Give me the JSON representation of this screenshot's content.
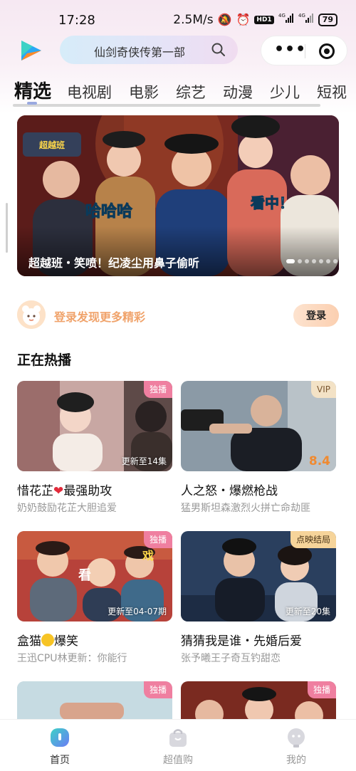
{
  "status_bar": {
    "time": "17:28",
    "speed": "2.5M/s",
    "hd": "HD1",
    "net1": "4G",
    "net2": "4G",
    "battery": "79"
  },
  "header": {
    "search_placeholder": "仙剑奇侠传第一部",
    "more_icon": "more-dots-icon",
    "close_icon": "target-close-icon"
  },
  "tabs": [
    {
      "label": "精选"
    },
    {
      "label": "电视剧"
    },
    {
      "label": "电影"
    },
    {
      "label": "综艺"
    },
    {
      "label": "动漫"
    },
    {
      "label": "少儿"
    },
    {
      "label": "短视"
    }
  ],
  "banner": {
    "title": "超越班・笑喷！纪凌尘用鼻子偷听",
    "caption_left": "哈哈哈",
    "caption_right": "看中！",
    "logo_text": "超越班"
  },
  "login": {
    "text": "登录发现更多精彩",
    "button": "登录"
  },
  "section_title": "正在热播",
  "cards": [
    {
      "title": "惜花芷",
      "title_suffix": "最强助攻",
      "subtitle": "奶奶鼓励花芷大胆追爱",
      "badge": "独播",
      "update": "更新至14集"
    },
    {
      "title": "人之怒・爆燃枪战",
      "subtitle": "猛男斯坦森激烈火拼亡命劫匪",
      "badge": "VIP",
      "score": "8.4"
    },
    {
      "title": "盒猫",
      "title_suffix": "爆笑",
      "subtitle": "王迅CPU林更新：你能行",
      "badge": "独播",
      "update": "更新至04-07期",
      "overlay_text": "看",
      "overlay_text2": "戏"
    },
    {
      "title": "猜猜我是谁・先婚后爱",
      "subtitle": "张予曦王子奇互钓甜恋",
      "badge": "点映结局",
      "update": "更新至20集"
    },
    {
      "badge": "独播"
    },
    {
      "badge": "独播"
    }
  ],
  "bottom_nav": [
    {
      "label": "首页",
      "active": true
    },
    {
      "label": "超值购",
      "active": false
    },
    {
      "label": "我的",
      "active": false
    }
  ],
  "colors": {
    "accent_orange": "#f0a36b",
    "badge_pink": "#ef7fa0",
    "score_orange": "#f08a30"
  }
}
